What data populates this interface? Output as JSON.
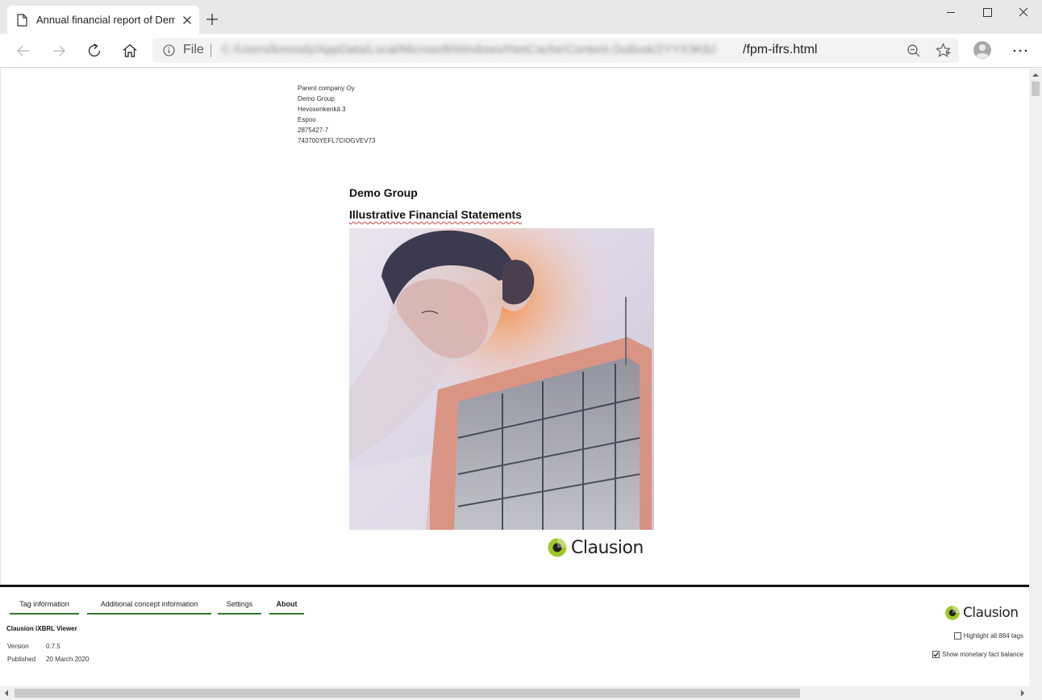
{
  "browser": {
    "tab_title": "Annual financial report of Demo Group",
    "address_scheme": "File",
    "address_path_obscured": "C:/Users/kmoody/AppData/Local/Microsoft/Windows/INetCache/Content.Outlook/ZYYX3K8J",
    "address_file": "/fpm-ifrs.html",
    "icons": [
      "page-icon",
      "close-icon",
      "plus-icon",
      "minimize-icon",
      "maximize-icon",
      "close-icon",
      "back-icon",
      "forward-icon",
      "reload-icon",
      "home-icon",
      "info-icon",
      "zoom-icon",
      "star-icon",
      "profile-icon",
      "more-icon"
    ]
  },
  "document": {
    "address_lines": [
      "Parent company Oy",
      "Demo Group",
      "Hevosenkenkä 3",
      "Espoo",
      "2875427-7",
      "743700YEFL7CIOGVEV73"
    ],
    "title": "Demo Group",
    "subtitle": "Illustrative Financial Statements",
    "logo_text": "Clausion"
  },
  "viewer": {
    "tabs": {
      "tag_information": "Tag information",
      "additional_concept": "Additional concept information",
      "settings": "Settings",
      "about": "About"
    },
    "active_tab": "About",
    "name": "Clausion iXBRL Viewer",
    "version_label": "Version",
    "version_value": "0.7.5",
    "published_label": "Published",
    "published_value": "20 March 2020",
    "logo_text": "Clausion",
    "highlight_label": "Highlight all 884 tags",
    "highlight_checked": false,
    "monetary_label": "Show monetary fact balance",
    "monetary_checked": true
  },
  "colors": {
    "tab_underline": "#2d7a2d",
    "logo_green": "#9cc925",
    "logo_dark": "#222222"
  }
}
